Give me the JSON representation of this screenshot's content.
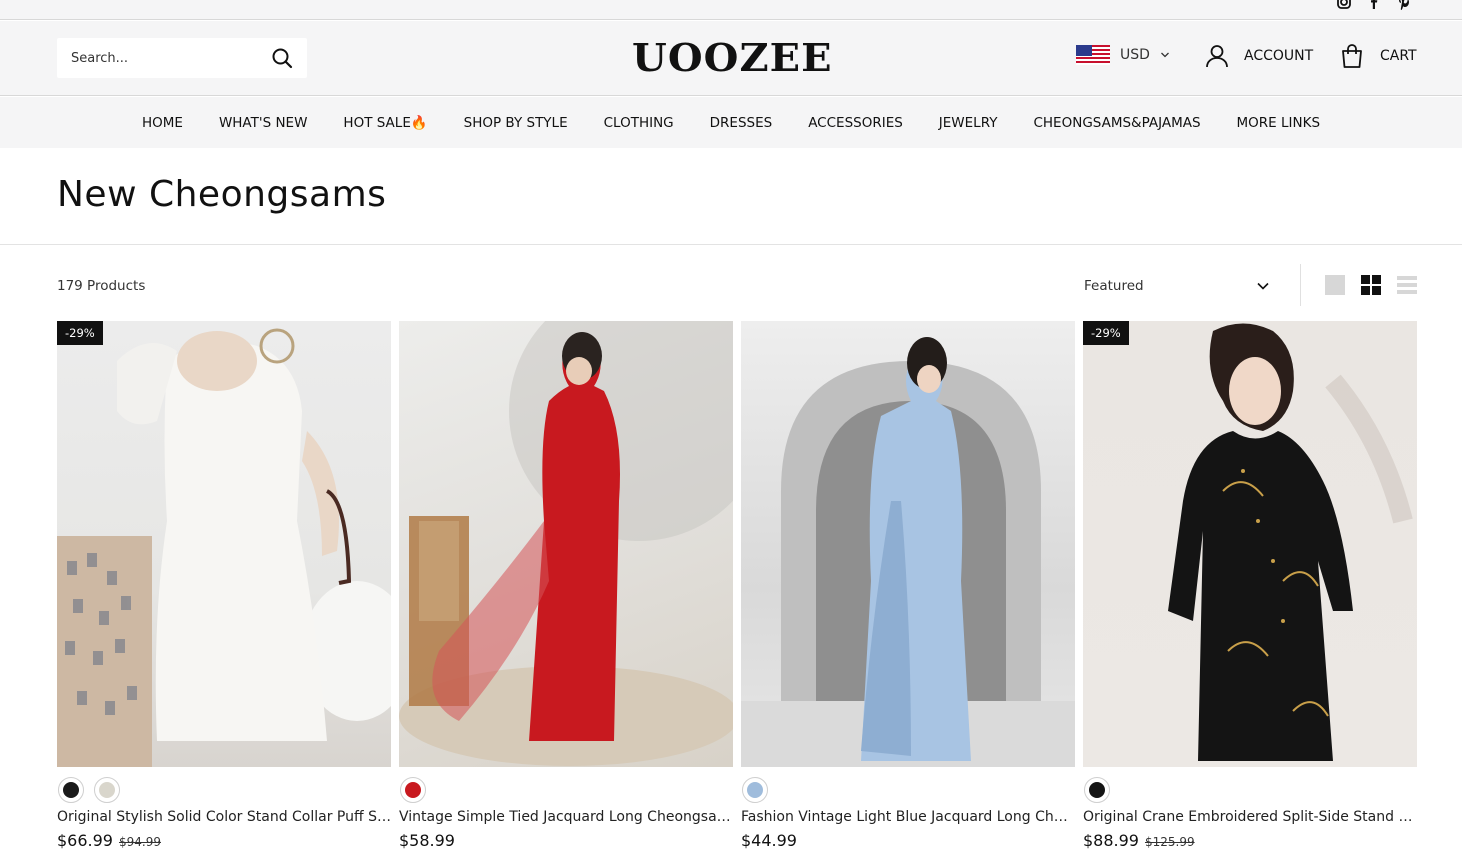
{
  "header": {
    "social": [
      "instagram-icon",
      "facebook-icon",
      "pinterest-icon"
    ],
    "search_placeholder": "Search...",
    "logo": "UOOZEE",
    "currency": "USD",
    "account_label": "ACCOUNT",
    "cart_label": "CART"
  },
  "nav": {
    "items": [
      "HOME",
      "WHAT'S NEW",
      "HOT SALE🔥",
      "SHOP BY STYLE",
      "CLOTHING",
      "DRESSES",
      "ACCESSORIES",
      "JEWELRY",
      "CHEONGSAMS&PAJAMAS",
      "MORE LINKS"
    ]
  },
  "collection": {
    "title": "New Cheongsams",
    "count": "179 Products",
    "sort_selected": "Featured"
  },
  "colors": {
    "accent": "#111111",
    "topbar_bg": "#f5f5f6"
  },
  "products": [
    {
      "badge": "-29%",
      "name": "Original Stylish Solid Color Stand Collar Puff Sleeve Cheongsam Dress",
      "price": "$66.99",
      "compare_price": "$94.99",
      "swatches": [
        "#1a1a1a",
        "#d9d6cc"
      ]
    },
    {
      "badge": "",
      "name": "Vintage Simple Tied Jacquard Long Cheongsam Dress",
      "price": "$58.99",
      "compare_price": "",
      "swatches": [
        "#c8191f"
      ]
    },
    {
      "badge": "",
      "name": "Fashion Vintage Light Blue Jacquard Long Cheongsam Dress",
      "price": "$44.99",
      "compare_price": "",
      "swatches": [
        "#9fbcdc"
      ]
    },
    {
      "badge": "-29%",
      "name": "Original Crane Embroidered Split-Side Stand Collar Cheongsam Dress",
      "price": "$88.99",
      "compare_price": "$125.99",
      "swatches": [
        "#151515"
      ]
    }
  ]
}
